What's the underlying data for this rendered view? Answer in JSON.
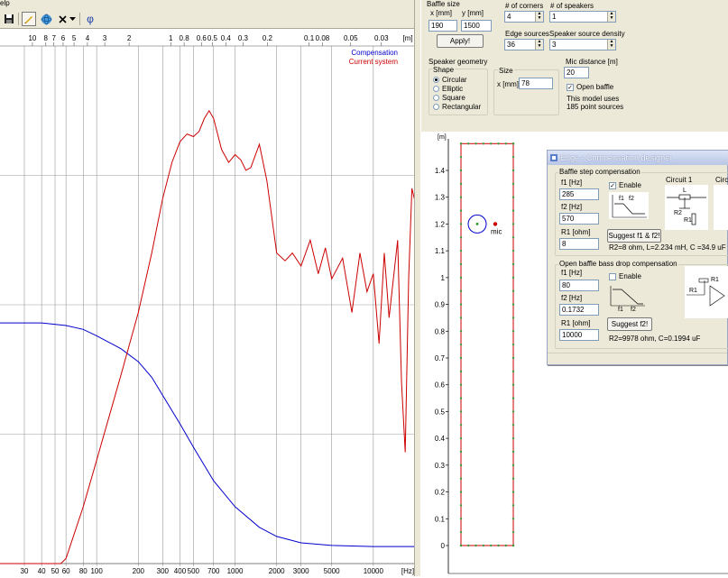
{
  "menubar": {
    "item": "elp"
  },
  "toolbar": {
    "icons": [
      "save-icon",
      "pencil-icon",
      "sphere-icon",
      "close-icon",
      "chevron-down-icon",
      "phi-icon"
    ],
    "phi_label": "φ"
  },
  "settings": {
    "baffle_size": {
      "title": "Baffle size",
      "x_label": "x [mm]",
      "y_label": "y [mm]",
      "x_value": "190",
      "y_value": "1500",
      "apply_label": "Apply!"
    },
    "corners": {
      "label": "# of corners",
      "value": "4"
    },
    "speakers": {
      "label": "# of speakers",
      "value": "1"
    },
    "edge_sources": {
      "label": "Edge sources",
      "value": "36"
    },
    "source_density": {
      "label": "Speaker source density",
      "value": "3"
    },
    "speaker_geometry": {
      "title": "Speaker geometry",
      "shape_title": "Shape",
      "shapes": [
        "Circular",
        "Elliptic",
        "Square",
        "Rectangular"
      ],
      "selected": "Circular",
      "size_title": "Size",
      "size_label": "x [mm]",
      "size_value": "78"
    },
    "mic_distance": {
      "label": "Mic distance [m]",
      "value": "20"
    },
    "open_baffle": {
      "label": "Open baffle",
      "checked": true
    },
    "model_info": [
      "This model uses",
      "185 point sources"
    ]
  },
  "left_chart": {
    "top_unit": "[m]",
    "top_ticks": [
      "10",
      "8",
      "7",
      "6",
      "5",
      "4",
      "3",
      "2",
      "1",
      "0.8",
      "0.6",
      "0.5",
      "0.4",
      "0.3",
      "0.2",
      "0.1",
      "0.08",
      "0.05",
      "0.03"
    ],
    "bottom_unit": "[Hz]",
    "bottom_ticks": [
      "30",
      "40",
      "50",
      "60",
      "80",
      "100",
      "200",
      "300",
      "400",
      "500",
      "700",
      "1000",
      "2000",
      "3000",
      "5000",
      "10000"
    ]
  },
  "baffle_plot": {
    "y_unit": "[m]",
    "y_ticks": [
      "1.4",
      "1.3",
      "1.2",
      "1.1",
      "1",
      "0.9",
      "0.8",
      "0.7",
      "0.6",
      "0.5",
      "0.4",
      "0.3",
      "0.2",
      "0.1",
      "0"
    ],
    "mic_label": "mic"
  },
  "compensation_dialog": {
    "title": "Edge - Compensation designer",
    "baffle_step": {
      "title": "Baffle step compensation",
      "f1_label": "f1 [Hz]",
      "f1_value": "285",
      "f2_label": "f2 [Hz]",
      "f2_value": "570",
      "r1_label": "R1 [ohm]",
      "r1_value": "8",
      "enable_label": "Enable",
      "enabled": true,
      "graph_f1": "f1",
      "graph_f2": "f2",
      "circuit1_label": "Circuit 1",
      "circuit2_label": "Circ",
      "circuit_L": "L",
      "circuit_R2": "R2",
      "circuit_R1": "R1",
      "suggest_label": "Suggest f1 & f2!",
      "result": "R2=8 ohm, L=2.234 mH, C =34.9 uF"
    },
    "bass_drop": {
      "title": "Open baffle bass drop compensation",
      "f1_label": "f1 [Hz]",
      "f1_value": "80",
      "f2_label": "f2 [Hz]",
      "f2_value": "0.1732",
      "r1_label": "R1 [ohm]",
      "r1_value": "10000",
      "enable_label": "Enable",
      "enabled": false,
      "graph_f1": "f1",
      "graph_f2": "f2",
      "circuit_R1": "R1",
      "suggest_label": "Suggest f2!",
      "result": "R2=9978 ohm, C=0.1994 uF"
    }
  },
  "chart_data": {
    "type": "line",
    "xscale": "log",
    "x_unit": "Hz",
    "xlim": [
      20,
      20000
    ],
    "series": [
      {
        "name": "Compensation",
        "color": "#0000cc",
        "points": [
          [
            20,
            0.93
          ],
          [
            40,
            0.93
          ],
          [
            60,
            0.92
          ],
          [
            80,
            0.905
          ],
          [
            100,
            0.88
          ],
          [
            150,
            0.83
          ],
          [
            200,
            0.78
          ],
          [
            250,
            0.72
          ],
          [
            300,
            0.65
          ],
          [
            400,
            0.54
          ],
          [
            500,
            0.45
          ],
          [
            700,
            0.32
          ],
          [
            1000,
            0.22
          ],
          [
            1500,
            0.14
          ],
          [
            2000,
            0.105
          ],
          [
            3000,
            0.08
          ],
          [
            5000,
            0.07
          ],
          [
            10000,
            0.066
          ],
          [
            20000,
            0.066
          ]
        ]
      },
      {
        "name": "Current system",
        "color": "#cc0000",
        "points": [
          [
            20,
            0.0
          ],
          [
            30,
            0.0
          ],
          [
            55,
            0.0
          ],
          [
            60,
            0.02
          ],
          [
            80,
            0.22
          ],
          [
            100,
            0.4
          ],
          [
            150,
            0.73
          ],
          [
            200,
            0.97
          ],
          [
            250,
            1.2
          ],
          [
            300,
            1.41
          ],
          [
            350,
            1.55
          ],
          [
            400,
            1.63
          ],
          [
            450,
            1.66
          ],
          [
            500,
            1.65
          ],
          [
            550,
            1.67
          ],
          [
            600,
            1.72
          ],
          [
            650,
            1.75
          ],
          [
            700,
            1.72
          ],
          [
            800,
            1.6
          ],
          [
            900,
            1.55
          ],
          [
            1000,
            1.58
          ],
          [
            1100,
            1.56
          ],
          [
            1200,
            1.52
          ],
          [
            1300,
            1.53
          ],
          [
            1500,
            1.62
          ],
          [
            1700,
            1.48
          ],
          [
            2000,
            1.2
          ],
          [
            2300,
            1.17
          ],
          [
            2600,
            1.2
          ],
          [
            3000,
            1.15
          ],
          [
            3500,
            1.25
          ],
          [
            4000,
            1.12
          ],
          [
            4500,
            1.22
          ],
          [
            5000,
            1.1
          ],
          [
            6000,
            1.18
          ],
          [
            7000,
            0.97
          ],
          [
            8000,
            1.2
          ],
          [
            9000,
            1.05
          ],
          [
            10000,
            1.12
          ],
          [
            11000,
            0.85
          ],
          [
            12000,
            1.2
          ],
          [
            13000,
            0.95
          ],
          [
            15000,
            1.25
          ],
          [
            16000,
            0.7
          ],
          [
            17000,
            0.43
          ],
          [
            18000,
            1.1
          ],
          [
            19000,
            1.45
          ],
          [
            20000,
            1.4
          ]
        ]
      }
    ],
    "legend": "top-right",
    "grid": true
  }
}
